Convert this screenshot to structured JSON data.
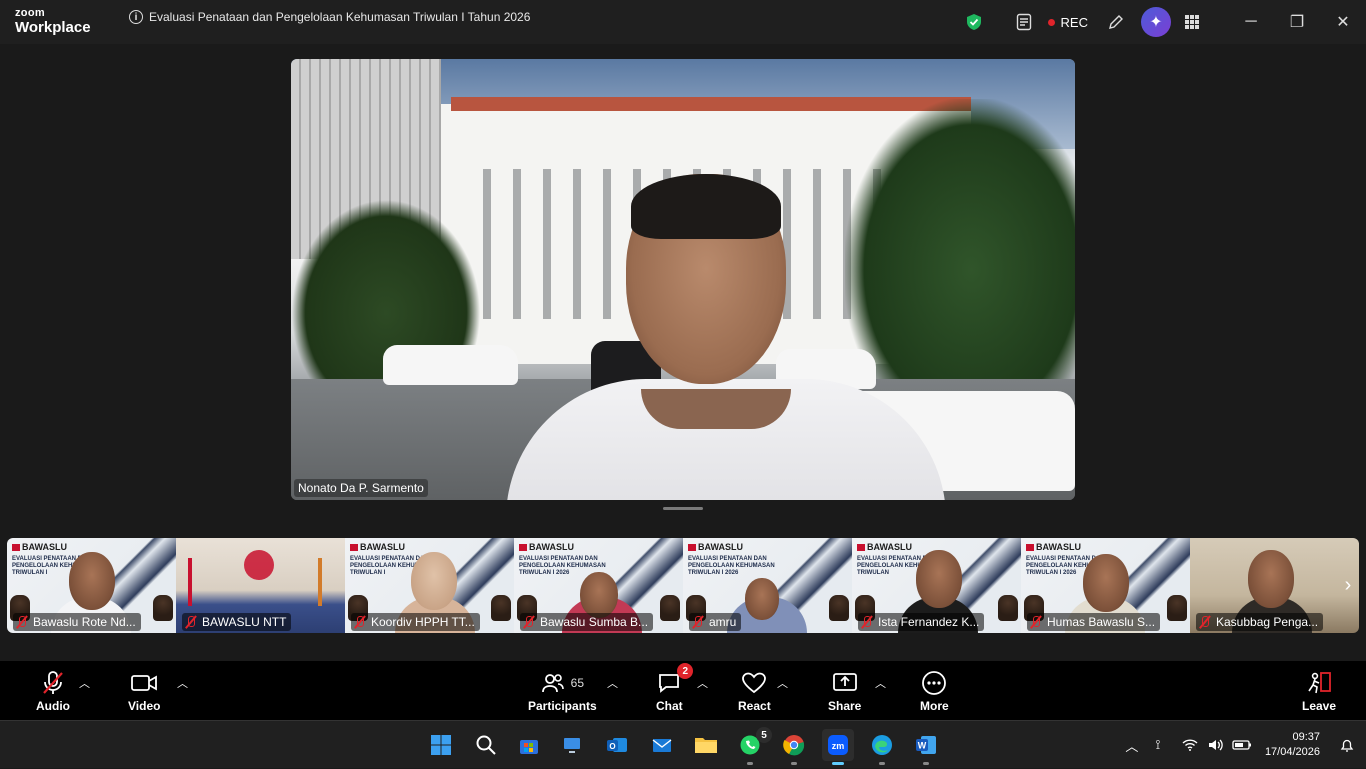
{
  "app": {
    "brand_top": "zoom",
    "brand_bottom": "Workplace",
    "meeting_title": "Evaluasi Penataan dan Pengelolaan Kehumasan Triwulan I  Tahun 2026",
    "rec_label": "REC"
  },
  "main_video": {
    "participant_name": "Nonato Da P. Sarmento"
  },
  "gallery": {
    "tiles": [
      {
        "name": "Bawaslu Rote Nd...",
        "logo": "BAWASLU",
        "headline": "EVALUASI PENATAAN DAN PENGELOLAAN KEHUMASAN TRIWULAN I"
      },
      {
        "name": "BAWASLU NTT",
        "logo": "",
        "headline": ""
      },
      {
        "name": "Koordiv HPPH TT...",
        "logo": "BAWASLU",
        "headline": "EVALUASI PENATAAN DAN PENGELOLAAN KEHUMASAN TRIWULAN I"
      },
      {
        "name": "Bawaslu Sumba B...",
        "logo": "BAWASLU",
        "headline": "EVALUASI PENATAAN DAN PENGELOLAAN KEHUMASAN TRIWULAN I 2026"
      },
      {
        "name": "amru",
        "logo": "BAWASLU",
        "headline": "EVALUASI PENATAAN DAN PENGELOLAAN KEHUMASAN TRIWULAN I 2026"
      },
      {
        "name": "Ista Fernandez K...",
        "logo": "BAWASLU",
        "headline": "EVALUASI PENATAAN DAN PENGELOLAAN KEHUMASAN TRIWULAN"
      },
      {
        "name": "Humas Bawaslu S...",
        "logo": "BAWASLU",
        "headline": "EVALUASI PENATAAN DAN PENGELOLAAN KEHUMASAN TRIWULAN I 2026"
      },
      {
        "name": "Kasubbag Penga...",
        "logo": "",
        "headline": ""
      }
    ]
  },
  "controls": {
    "audio": "Audio",
    "video": "Video",
    "participants": "Participants",
    "participants_count": "65",
    "chat": "Chat",
    "chat_badge": "2",
    "react": "React",
    "share": "Share",
    "more": "More",
    "leave": "Leave"
  },
  "taskbar": {
    "whatsapp_badge": "5",
    "time": "09:37",
    "date": "17/04/2026"
  },
  "colors": {
    "accent_red": "#e0242b",
    "shield_green": "#1fb85f",
    "ai_purple": "#6a4bd6",
    "taskbar_active": "#60cdff"
  }
}
